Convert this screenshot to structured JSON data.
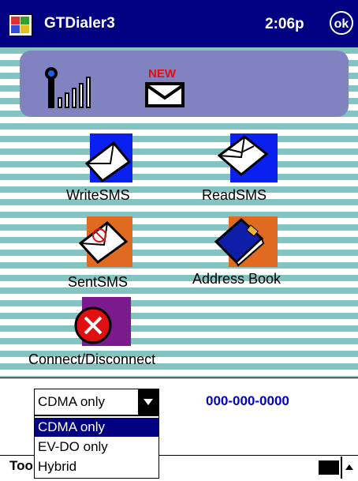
{
  "titlebar": {
    "app_title": "GTDialer3",
    "clock": "2:06p",
    "ok_label": "ok"
  },
  "apps": [
    {
      "label": "WriteSMS"
    },
    {
      "label": "ReadSMS"
    },
    {
      "label": "SentSMS"
    },
    {
      "label": "Address Book"
    },
    {
      "label": "Connect/Disconnect"
    }
  ],
  "status": {
    "new_badge": "NEW"
  },
  "network_mode": {
    "selected": "CDMA only",
    "options": [
      "CDMA only",
      "EV-DO only",
      "Hybrid"
    ]
  },
  "phone_number": "000-000-0000",
  "menubar": {
    "tools_label": "Too"
  },
  "colors": {
    "title_bar": "#000080",
    "stripe": "#83c3c2",
    "panel": "#8183c1",
    "phone": "#0000c0"
  }
}
